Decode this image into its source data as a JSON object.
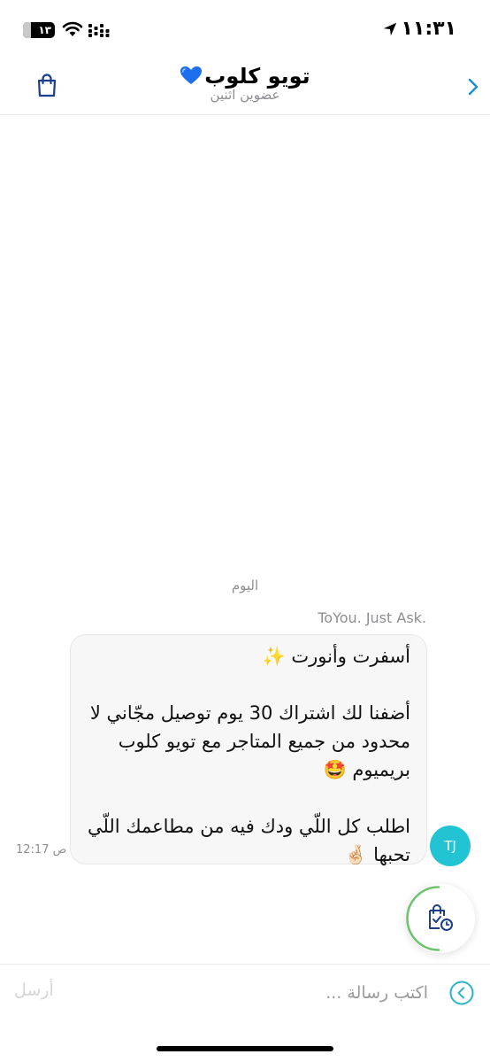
{
  "status_bar": {
    "time": "١١:٣١",
    "battery_label": "١٣",
    "icons": [
      "location-arrow-icon",
      "wifi-icon",
      "signal-icon",
      "battery-icon"
    ]
  },
  "header": {
    "title": "تويو كلوب",
    "title_emoji": "blue-heart-icon",
    "subtitle": "عضوين اثنين",
    "back_icon": "chevron-right-icon",
    "cart_icon": "shopping-bag-icon",
    "accent_color": "#1a6fd6"
  },
  "chat": {
    "day_label": "اليوم",
    "messages": [
      {
        "sender": "ToYou. Just Ask.",
        "avatar_initials": "TJ",
        "avatar_color": "#22c4d4",
        "text": "أسفرت وأنورت ✨\n\nأضفنا لك اشتراك 30 يوم توصيل مجّاني لا محدود من جميع المتاجر مع تويو كلوب بريميوم 🤩\n\nاطلب كل اللّي ودك فيه من مطاعمك اللّي تحبها 🤞🏻",
        "time": "12:17 ص"
      }
    ]
  },
  "fab": {
    "icon": "order-history-bag-icon",
    "ring_color": "#6cc36c"
  },
  "composer": {
    "placeholder": "اكتب رسالة ...",
    "value": "",
    "send_label": "أرسل",
    "expand_icon": "chevron-left-circle-icon"
  }
}
